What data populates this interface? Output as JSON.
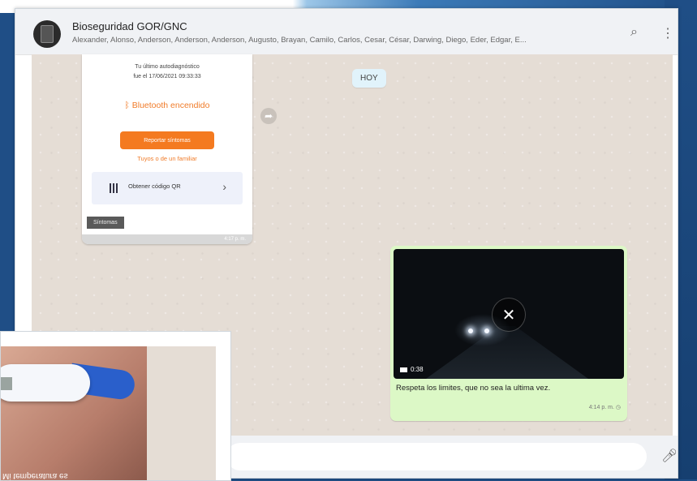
{
  "header": {
    "title": "Bioseguridad GOR/GNC",
    "members": "Alexander, Alonso, Anderson, Anderson, Anderson, Augusto, Brayan, Camilo, Carlos, Cesar, César, Darwing, Diego, Eder, Edgar, E...",
    "search_icon": "search-icon",
    "menu_icon": "more-vertical-icon"
  },
  "chat": {
    "date_chip": "HOY",
    "screenshot_card": {
      "diag_line1": "Tu último autodiagnóstico",
      "diag_line2": "fue el 17/06/2021 09:33:33",
      "bluetooth": "Bluetooth encendido",
      "report_button": "Reportar síntomas",
      "family_link": "Tuyos o de un familiar",
      "qr_label": "Obtener código QR",
      "sintomas_tab": "Síntomas",
      "time": "4:17 p. m."
    },
    "video_message": {
      "duration": "0:38",
      "caption": "Respeta los limites, que no sea la ultima vez.",
      "time": "4:14 p. m."
    }
  },
  "overlay": {
    "mirror_text": "Mi temperatura es"
  },
  "colors": {
    "chat_bg": "#e5ddd5",
    "outgoing": "#dcf8c6",
    "accent_orange": "#f47a20"
  }
}
